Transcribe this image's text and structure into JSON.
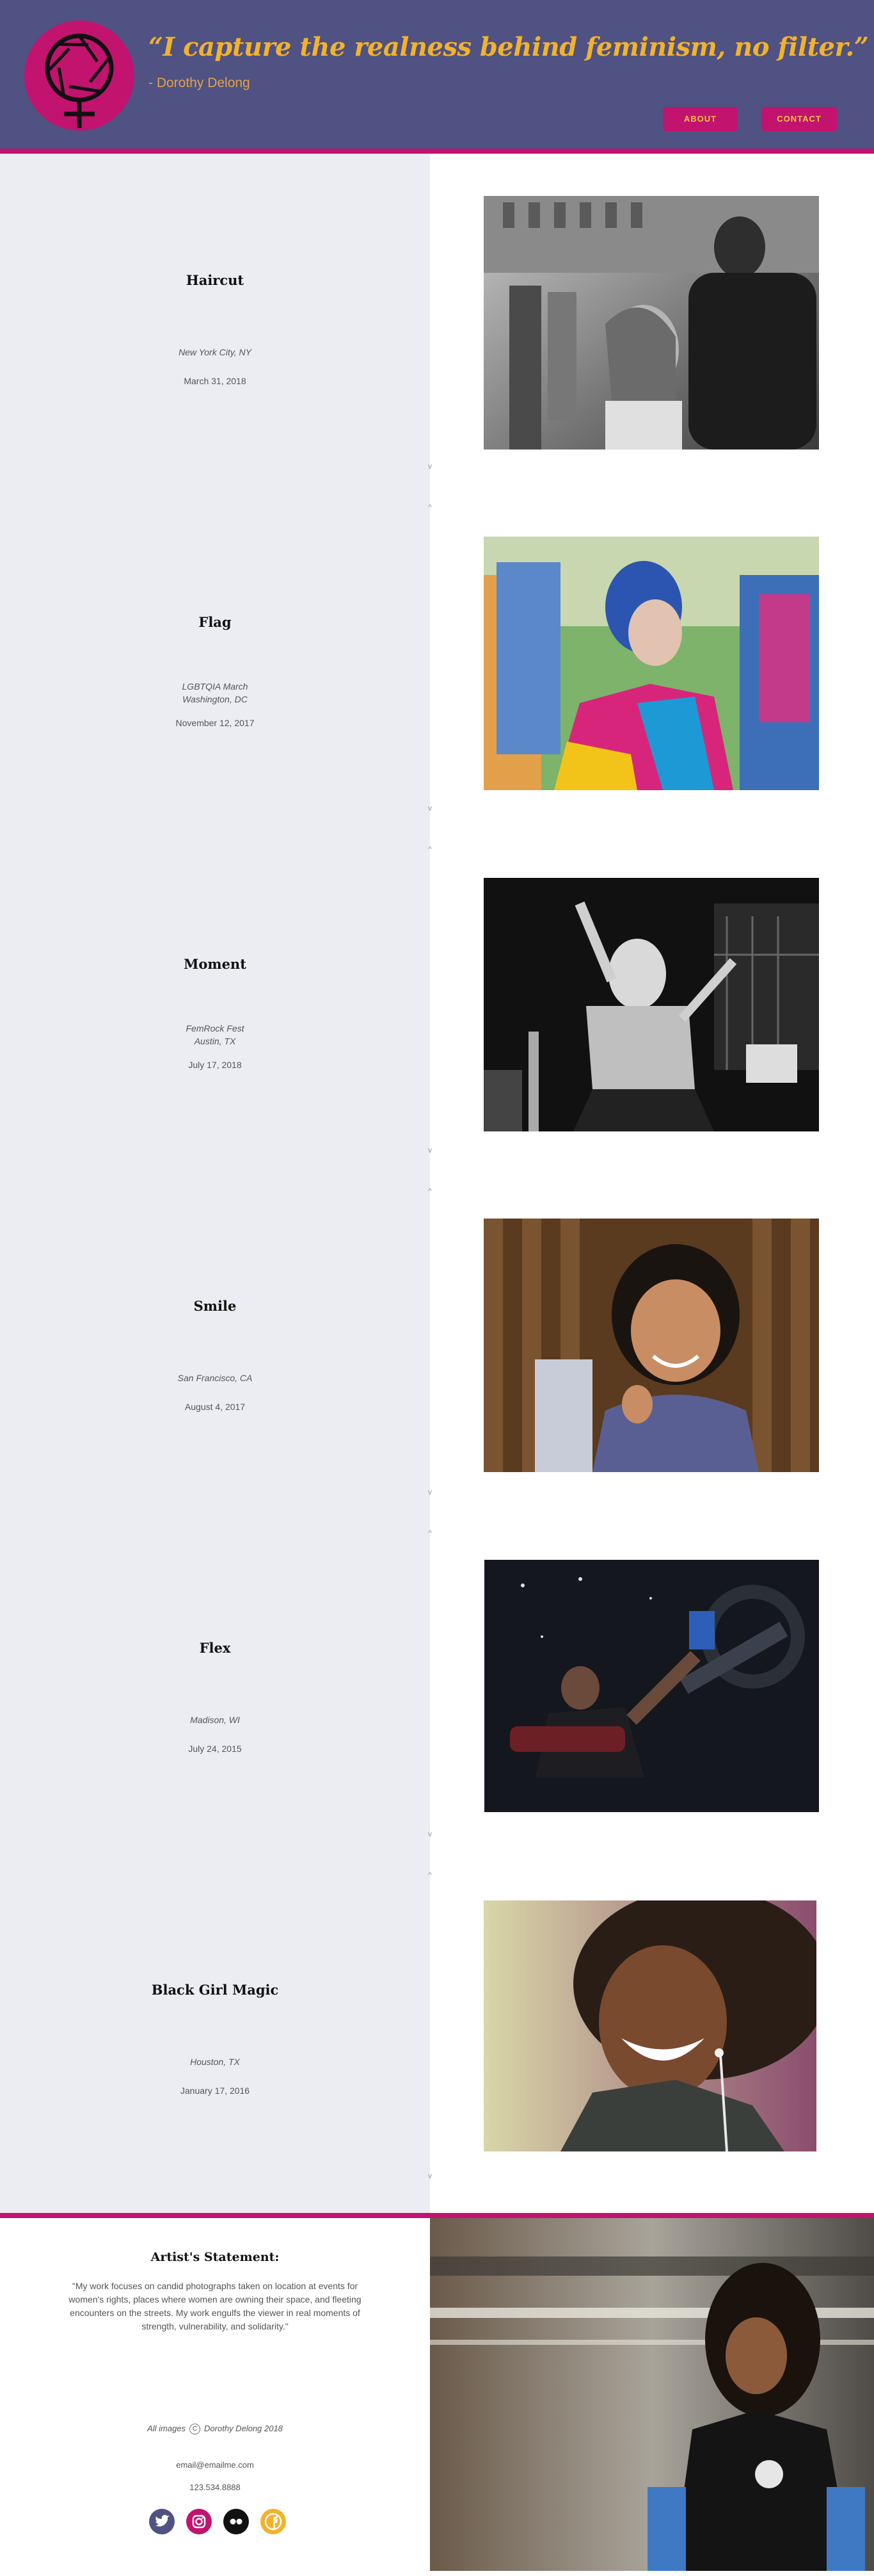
{
  "header": {
    "quote": "“I capture the realness behind feminism, no filter.”",
    "author": "- Dorothy Delong",
    "nav": {
      "about": "ABOUT",
      "contact": "CONTACT"
    },
    "logo_icon": "camera-aperture-venus-logo"
  },
  "colors": {
    "header_bg": "#4f5282",
    "accent_magenta": "#c2136f",
    "accent_gold": "#f3b22c",
    "panel_bg": "#ecedf3"
  },
  "entries": [
    {
      "title": "Haircut",
      "location": [
        "New York City, NY"
      ],
      "date": "March 31, 2018",
      "photo": "grayscale street haircut"
    },
    {
      "title": "Flag",
      "location": [
        "LGBTQIA March",
        "Washington, DC"
      ],
      "date": "November 12, 2017",
      "photo": "woman with blue hair and pride flag"
    },
    {
      "title": "Moment",
      "location": [
        "FemRock Fest",
        "Austin, TX"
      ],
      "date": "July 17, 2018",
      "photo": "grayscale singer on stage"
    },
    {
      "title": "Smile",
      "location": [
        "San Francisco, CA"
      ],
      "date": "August 4, 2017",
      "photo": "smiling child"
    },
    {
      "title": "Flex",
      "location": [
        "Madison, WI"
      ],
      "date": "July 24, 2015",
      "photo": "woman at leg press machine"
    },
    {
      "title": "Black Girl Magic",
      "location": [
        "Houston, TX"
      ],
      "date": "January 17, 2016",
      "photo": "laughing woman with earphones"
    }
  ],
  "chevrons": {
    "down": "v",
    "up": "^"
  },
  "footer": {
    "statement_title": "Artist's Statement:",
    "statement": "\"My work focuses on candid photographs taken on location at events for women's rights, places where women are owning their space, and fleeting encounters on the streets. My work engulfs the viewer in real moments of strength, vulnerability, and solidarity.\"",
    "credit_prefix": "All images",
    "copyright_symbol": "C",
    "credit_suffix": "Dorothy Delong 2018",
    "email": "email@emailme.com",
    "phone": "123.534.8888",
    "social_icons": [
      "twitter-icon",
      "instagram-icon",
      "flickr-icon",
      "facebook-icon"
    ]
  }
}
